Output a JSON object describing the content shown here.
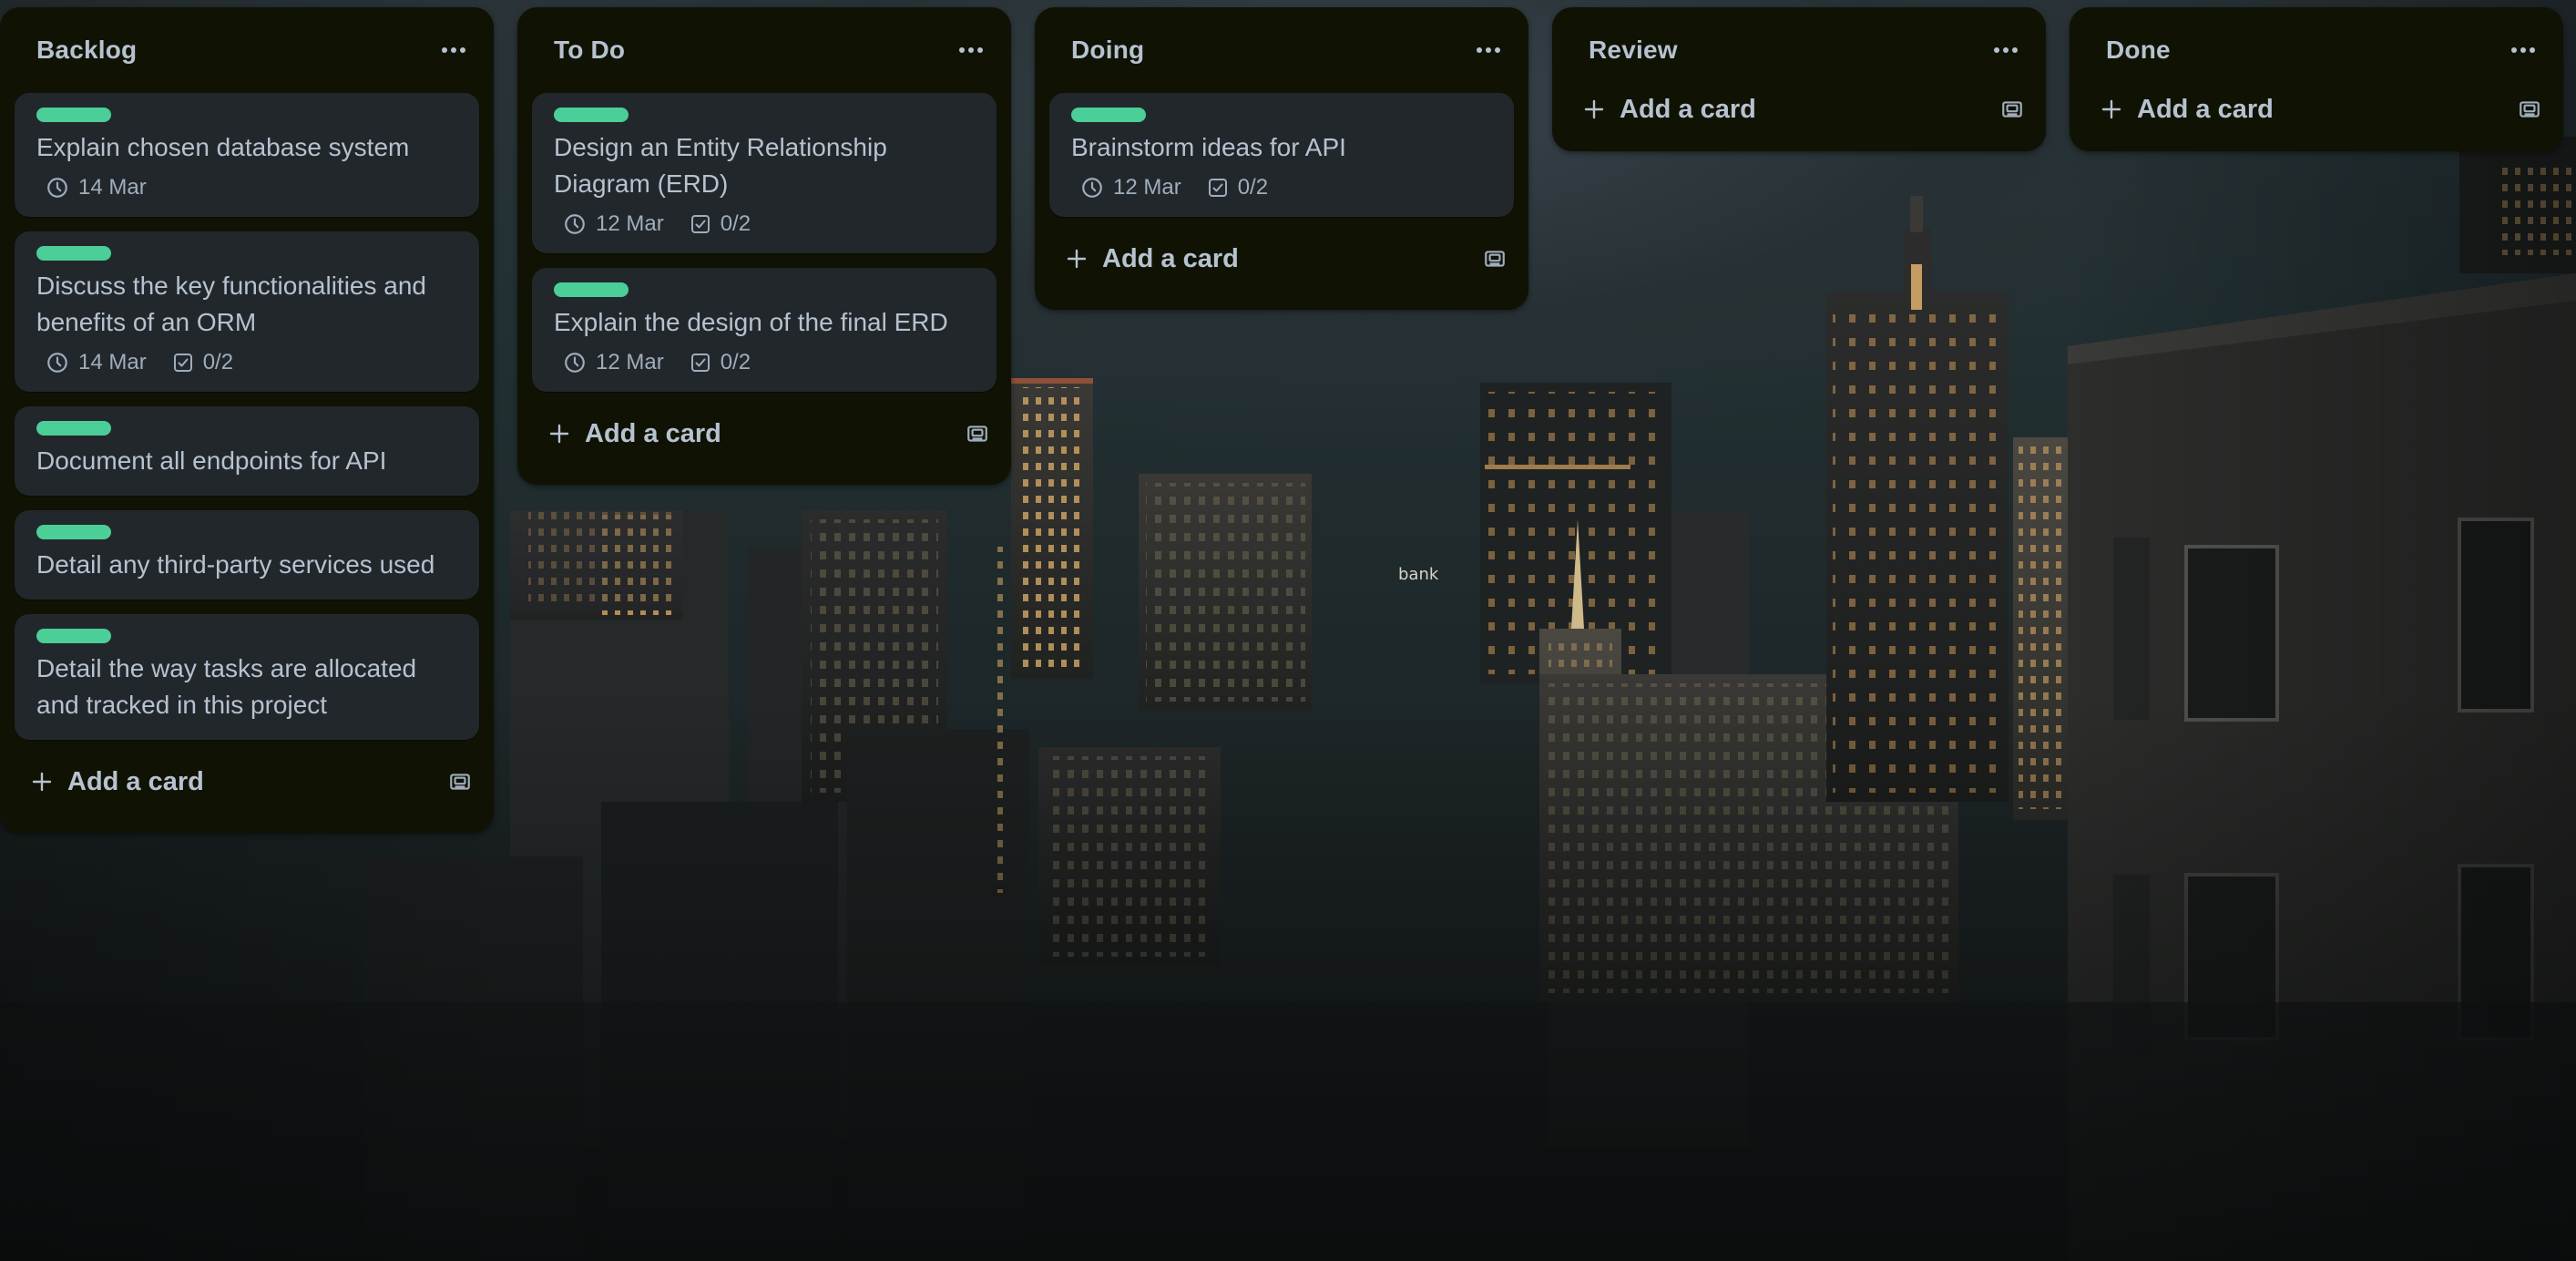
{
  "board": {
    "lists": [
      {
        "title": "Backlog",
        "menu_icon": "ellipsis-icon",
        "cards": [
          {
            "label_color": "#4bce97",
            "title": "Explain chosen database system",
            "due": "14 Mar",
            "checklist": ""
          },
          {
            "label_color": "#4bce97",
            "title": "Discuss the key functionalities and benefits of an ORM",
            "due": "14 Mar",
            "checklist": "0/2"
          },
          {
            "label_color": "#4bce97",
            "title": "Document all endpoints for API",
            "due": "",
            "checklist": ""
          },
          {
            "label_color": "#4bce97",
            "title": "Detail any third-party services used",
            "due": "",
            "checklist": ""
          },
          {
            "label_color": "#4bce97",
            "title": "Detail the way tasks are allocated and tracked in this project",
            "due": "",
            "checklist": ""
          }
        ],
        "add_card_label": "Add a card",
        "template_icon": "card-template-icon"
      },
      {
        "title": "To Do",
        "menu_icon": "ellipsis-icon",
        "cards": [
          {
            "label_color": "#4bce97",
            "title": "Design an Entity Relationship Diagram (ERD)",
            "due": "12 Mar",
            "checklist": "0/2"
          },
          {
            "label_color": "#4bce97",
            "title": "Explain the design of the final ERD",
            "due": "12 Mar",
            "checklist": "0/2"
          }
        ],
        "add_card_label": "Add a card",
        "template_icon": "card-template-icon"
      },
      {
        "title": "Doing",
        "menu_icon": "ellipsis-icon",
        "cards": [
          {
            "label_color": "#4bce97",
            "title": "Brainstorm ideas for API",
            "due": "12 Mar",
            "checklist": "0/2"
          }
        ],
        "add_card_label": "Add a card",
        "template_icon": "card-template-icon"
      },
      {
        "title": "Review",
        "menu_icon": "ellipsis-icon",
        "cards": [],
        "add_card_label": "Add a card",
        "template_icon": "card-template-icon"
      },
      {
        "title": "Done",
        "menu_icon": "ellipsis-icon",
        "cards": [],
        "add_card_label": "Add a card",
        "template_icon": "card-template-icon"
      }
    ]
  },
  "background": {
    "sign_text": "bank"
  },
  "colors": {
    "list_bg": "#101204",
    "card_bg": "#22272b",
    "label_green": "#4bce97",
    "text_primary": "#b6c2cf",
    "text_secondary": "#9fadbc"
  },
  "icons": {
    "due": "clock-icon",
    "checklist": "checkbox-icon",
    "add": "plus-icon"
  }
}
